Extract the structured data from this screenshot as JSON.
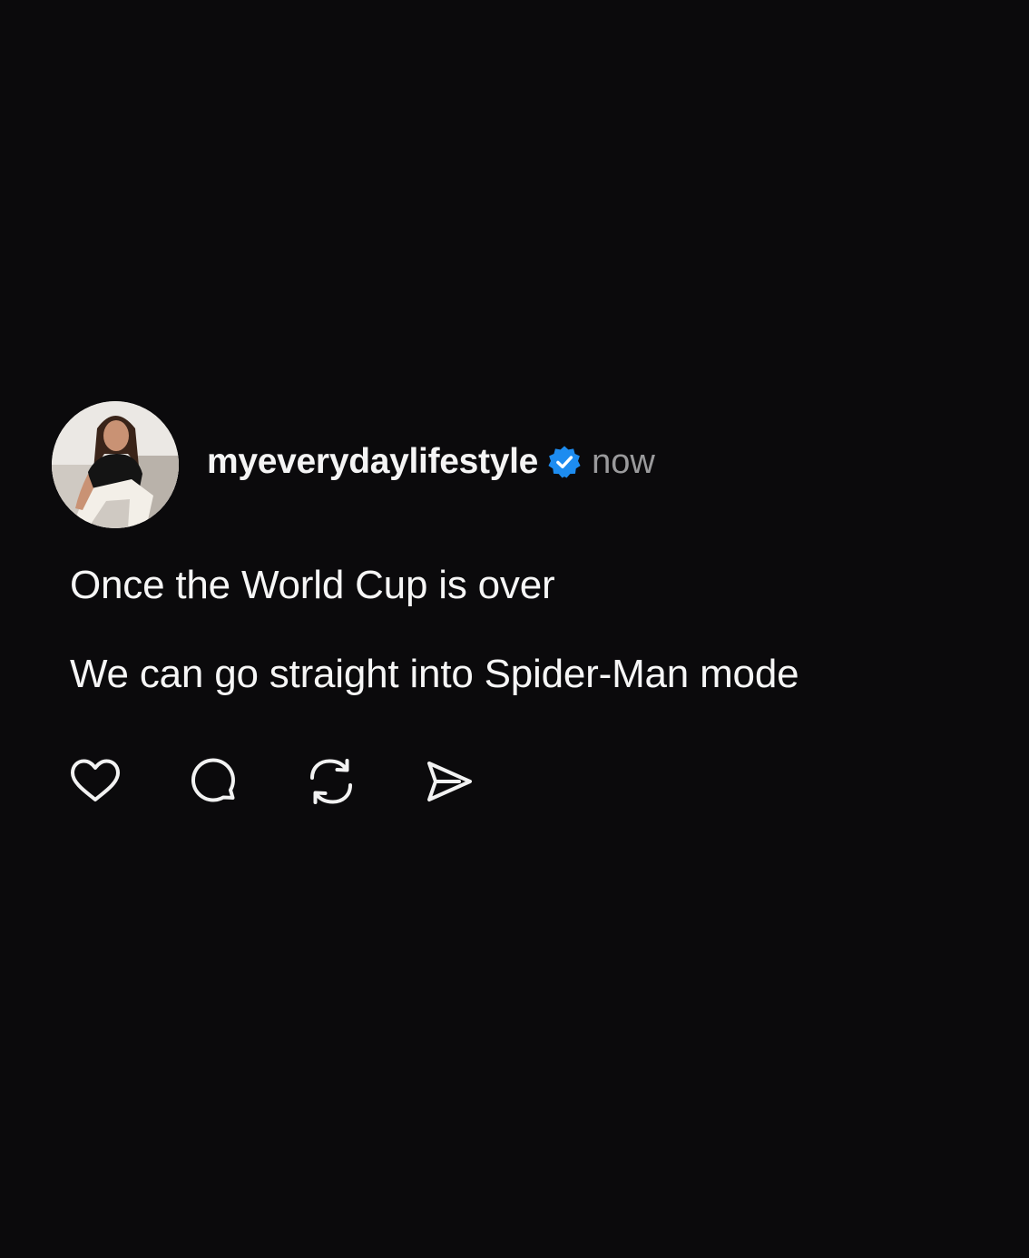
{
  "post": {
    "author": {
      "username": "myeverydaylifestyle",
      "verified": true,
      "avatar": "profile-photo-woman-sitting"
    },
    "timestamp": "now",
    "text_lines": [
      "Once the World Cup is over",
      "We can go straight into Spider-Man mode"
    ],
    "actions": [
      {
        "icon": "heart-icon",
        "name": "like"
      },
      {
        "icon": "comment-icon",
        "name": "comment"
      },
      {
        "icon": "repost-icon",
        "name": "repost"
      },
      {
        "icon": "send-icon",
        "name": "share"
      }
    ]
  },
  "colors": {
    "background": "#0b0a0c",
    "text": "#f6f6f6",
    "muted": "#9a9a9c",
    "verified_blue": "#1d8cf0"
  }
}
